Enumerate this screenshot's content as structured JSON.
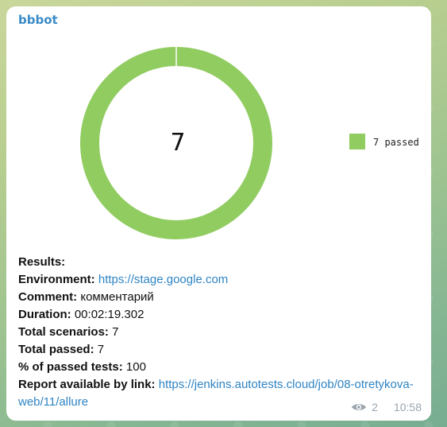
{
  "message": {
    "sender": "bbbot",
    "views": "2",
    "time": "10:58"
  },
  "chart_data": {
    "type": "pie",
    "donut": true,
    "center_label": "7",
    "slices": [
      {
        "label": "7 passed",
        "value": 7,
        "color": "#91cc61"
      }
    ],
    "legend_position": "right"
  },
  "report": {
    "results_label": "Results:",
    "environment_label": "Environment:",
    "environment_value": "https://stage.google.com",
    "comment_label": "Comment:",
    "comment_value": "комментарий",
    "duration_label": "Duration:",
    "duration_value": "00:02:19.302",
    "total_scenarios_label": "Total scenarios:",
    "total_scenarios_value": "7",
    "total_passed_label": "Total passed:",
    "total_passed_value": "7",
    "percent_label": "% of passed tests:",
    "percent_value": "100",
    "link_label": "Report available by link:",
    "link_value": "https://jenkins.autotests.cloud/job/08-otretykova-web/11/allure"
  }
}
